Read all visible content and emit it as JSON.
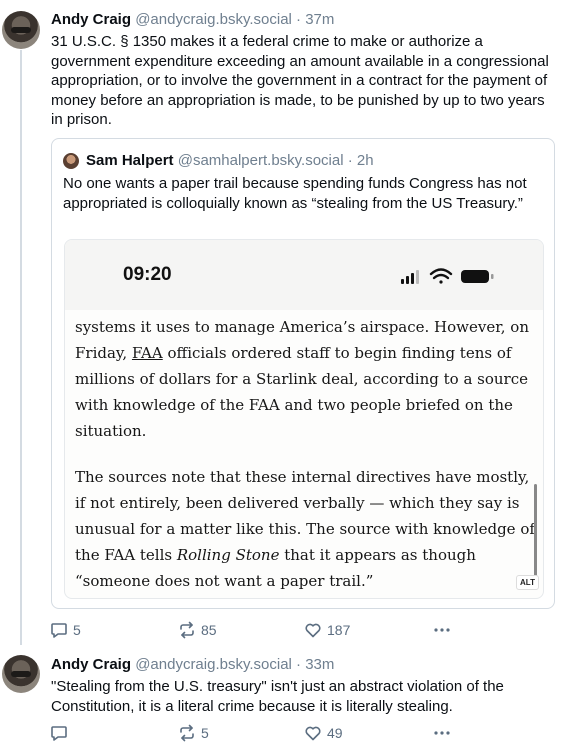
{
  "posts": [
    {
      "author": "Andy Craig",
      "handle": "@andycraig.bsky.social",
      "separator": "·",
      "time": "37m",
      "text": "31 U.S.C. § 1350 makes it a federal crime to make or authorize a government expenditure exceeding an amount available in a congressional appropriation, or to involve the government in a contract for the payment of money before an appropriation is made, to be punished by up to two years in prison.",
      "quote": {
        "author": "Sam Halpert",
        "handle": "@samhalpert.bsky.social",
        "separator": "·",
        "time": "2h",
        "text": "No one wants a paper trail because spending funds Congress has not appropriated is colloquially known as “stealing from the US Treasury.”",
        "screenshot": {
          "status_time": "09:20",
          "para1_a": "systems it uses to manage America’s airspace. However, on Friday, ",
          "para1_link": "FAA",
          "para1_b": " officials ordered staff to begin finding tens of millions of dollars for a Starlink deal, according to a source with knowledge of the FAA and two people briefed on the situation.",
          "para2_a": "The sources note that these internal directives have mostly, if not entirely, been delivered verbally — which they say is unusual for a matter like this. The source with knowledge of the FAA tells ",
          "para2_em": "Rolling Stone",
          "para2_b": " that it appears as though “someone does not want a paper trail.”",
          "alt_badge": "ALT"
        }
      },
      "actions": {
        "replies": "5",
        "reposts": "85",
        "likes": "187"
      }
    },
    {
      "author": "Andy Craig",
      "handle": "@andycraig.bsky.social",
      "separator": "·",
      "time": "33m",
      "text": "\"Stealing from the U.S. treasury\" isn't just an abstract violation of the Constitution, it is a literal crime because it is literally stealing.",
      "actions": {
        "replies": "",
        "reposts": "5",
        "likes": "49"
      }
    }
  ],
  "icons": {
    "reply": "speech-bubble-icon",
    "repost": "repost-arrows-icon",
    "like": "heart-outline-icon",
    "more": "ellipsis-icon"
  },
  "colors": {
    "action_gray": "#5b6d80",
    "handle_gray": "#6f7f8f",
    "thread_line": "#d4dbe2"
  }
}
